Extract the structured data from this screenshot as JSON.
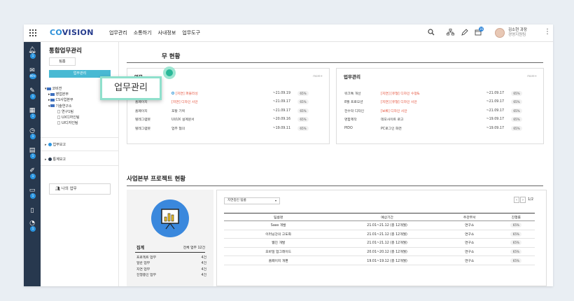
{
  "topbar": {
    "logo_prefix": "CO",
    "logo_suffix": "VISION",
    "nav": [
      "업무관리",
      "소통하기",
      "사내정보",
      "업무도구"
    ],
    "icons": [
      "search-icon",
      "org-chart-icon",
      "pen-icon",
      "calendar-icon"
    ],
    "calendar_badge": "16",
    "user_name": "김소현 과장",
    "user_dept": "경영지원팀"
  },
  "sidebar": {
    "icons": [
      "bell-icon",
      "mail-icon",
      "pen-icon",
      "calendar-icon",
      "clock-icon",
      "document-icon",
      "edit-icon",
      "chat-icon",
      "file-icon",
      "chart-icon"
    ],
    "badges": [
      "1",
      "99+",
      "1",
      "1",
      "1",
      "1",
      "1",
      "1",
      "",
      "1"
    ]
  },
  "tree": {
    "title": "통합업무관리",
    "team_button": "팀홈",
    "active_bar": "업무관리",
    "items": [
      {
        "label": "코비젼",
        "level": 0,
        "type": "folder"
      },
      {
        "label": "영업본부",
        "level": 1,
        "type": "folder"
      },
      {
        "label": "CS사업본부",
        "level": 1,
        "type": "folder"
      },
      {
        "label": "기술연구소",
        "level": 1,
        "type": "folder"
      },
      {
        "label": "연구1팀",
        "level": 2,
        "type": "doc"
      },
      {
        "label": "UX디자인팀",
        "level": 2,
        "type": "doc"
      },
      {
        "label": "UI디자인팀",
        "level": 2,
        "type": "doc"
      }
    ],
    "section_report": "업무보고",
    "section_stats": "통계보고",
    "my_task": "나의 업무"
  },
  "callout": {
    "label": "업무관리"
  },
  "main": {
    "section1_title": "무 현황",
    "card_left": {
      "title": "업무",
      "more": "more+",
      "rows": [
        {
          "cat": "홈페이지",
          "task": "[지연] 퍼블리싱",
          "red": true,
          "ring": true,
          "date": "~21.09.19",
          "pct": "65%"
        },
        {
          "cat": "홈페이지",
          "task": "[지연] 디자인 시안",
          "red": true,
          "ring": false,
          "date": "~21.09.17",
          "pct": "65%"
        },
        {
          "cat": "홈페이지",
          "task": "포탈 기획",
          "red": false,
          "ring": false,
          "date": "~21.09.17",
          "pct": "65%"
        },
        {
          "cat": "텔레그램봇",
          "task": "UI/UX 설계문서",
          "red": false,
          "ring": false,
          "date": "~20.09.16",
          "pct": "65%"
        },
        {
          "cat": "텔레그램봇",
          "task": "업무 협의",
          "red": false,
          "ring": false,
          "date": "~19.09.11",
          "pct": "65%"
        }
      ]
    },
    "card_right": {
      "title": "업무관리",
      "more": "more+",
      "rows": [
        {
          "cat": "워크톡 개선",
          "task": "[지연] [유형] 디자인 수정&",
          "red": true,
          "date": "~21.09.17",
          "pct": "65%"
        },
        {
          "cat": "8월 프로모션",
          "task": "[지연] [유형] 디자인 시안",
          "red": true,
          "date": "~21.09.17",
          "pct": "65%"
        },
        {
          "cat": "전수막 디자인",
          "task": "[보류] 디자인 시안",
          "red": true,
          "date": "~21.09.17",
          "pct": "65%"
        },
        {
          "cat": "명함제작",
          "task": "데모사이트 로고",
          "red": false,
          "date": "~19.09.17",
          "pct": "65%"
        },
        {
          "cat": "PIDO",
          "task": "PC로그인 화면",
          "red": false,
          "date": "~19.09.17",
          "pct": "65%"
        }
      ]
    },
    "section2_title": "사업본부 프로젝트 현황",
    "summary": {
      "title": "집계",
      "total": "전체 업무 12건",
      "items": [
        {
          "label": "프로젝트 업무",
          "count": "4건"
        },
        {
          "label": "일반 업무",
          "count": "4건"
        },
        {
          "label": "지연 업무",
          "count": "4건"
        },
        {
          "label": "진행중인 업무",
          "count": "4건"
        }
      ]
    },
    "projects": {
      "filter": "지연중인 팀룸",
      "page": "1/2",
      "headers": [
        "팀룸명",
        "예상기간",
        "주관부서",
        "진행률"
      ],
      "rows": [
        {
          "name": "Saas 개발",
          "period": "21.01~21.12 (총 12개월)",
          "dept": "연구소",
          "pct": "65%"
        },
        {
          "name": "이러닝강의 고도화",
          "period": "21.01~21.12 (총 12개월)",
          "dept": "연구소",
          "pct": "65%"
        },
        {
          "name": "웹진 개발",
          "period": "21.01~21.12 (총 12개월)",
          "dept": "연구소",
          "pct": "65%"
        },
        {
          "name": "모바일 업그레이드",
          "period": "20.01~20.12 (총 12개월)",
          "dept": "연구소",
          "pct": "65%"
        },
        {
          "name": "홈페이지 개편",
          "period": "19.01~19.12 (총 12개월)",
          "dept": "연구소",
          "pct": "65%"
        }
      ]
    }
  }
}
